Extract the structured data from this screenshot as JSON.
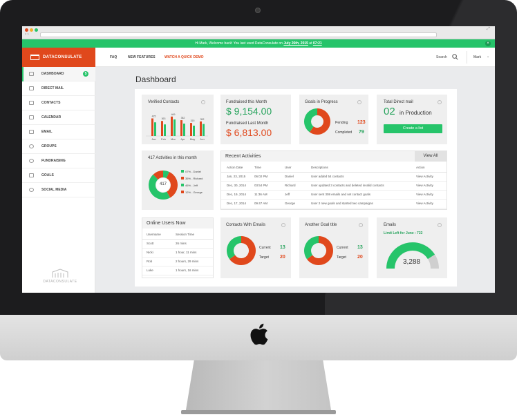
{
  "colors": {
    "green": "#26c46a",
    "orange": "#e0481c",
    "bezel": "#1c1c1e"
  },
  "welcome": {
    "prefix": "Hi Mark, Welcome back! You last used DataConsulate on ",
    "date": "July 26th, 2015",
    "mid": " at ",
    "time": "07:21"
  },
  "logo": {
    "text": "DATACONSULATE"
  },
  "topnav": {
    "faq": "FAQ",
    "features": "NEW FEATURES",
    "demo": "WATCH A QUICK DEMO",
    "search": "Search",
    "user": "Mark"
  },
  "sidebar": {
    "items": [
      {
        "label": "DASHBOARD",
        "icon": "dashboard-icon"
      },
      {
        "label": "DIRECT MAIL",
        "icon": "mail-icon"
      },
      {
        "label": "CONTACTS",
        "icon": "contacts-icon"
      },
      {
        "label": "CALENDAR",
        "icon": "calendar-icon"
      },
      {
        "label": "EMAIL",
        "icon": "email-icon"
      },
      {
        "label": "GROUPS",
        "icon": "groups-icon"
      },
      {
        "label": "FUNDRAISING",
        "icon": "fundraising-icon"
      },
      {
        "label": "GOALS",
        "icon": "goals-icon"
      },
      {
        "label": "SOCIAL MEDIA",
        "icon": "share-icon"
      }
    ],
    "badge": "5",
    "footer_logo": "DATACONSULATE"
  },
  "page": {
    "title": "Dashboard"
  },
  "verified": {
    "title": "Verified Contacts"
  },
  "chart_data": {
    "type": "bar",
    "title": "Verified Contacts",
    "categories": [
      "Jan",
      "Feb",
      "Mar",
      "Apr",
      "May",
      "Jun"
    ],
    "series": [
      {
        "values": [
          425,
          363,
          469,
          382,
          315,
          352
        ]
      },
      {
        "values": [
          330,
          280,
          400,
          300,
          250,
          290
        ]
      }
    ]
  },
  "fundraised": {
    "this_label": "Fundraised this Month",
    "this_value": "$ 9,154.00",
    "last_label": "Fundraised Last Month",
    "last_value": "$ 6,813.00"
  },
  "goals": {
    "title": "Goals in Progress",
    "pending_label": "Pending",
    "pending": "123",
    "completed_label": "Completed",
    "completed": "79",
    "pending_fraction": 0.6
  },
  "directmail": {
    "title": "Total Direct mail",
    "count": "02",
    "suffix": "in Production",
    "button": "Create a list"
  },
  "activities_donut": {
    "title": "417 Activities in this month",
    "center": "417",
    "legend": [
      {
        "label": "07% - Daniel",
        "color": "#26c46a",
        "value": 7
      },
      {
        "label": "35% - Richard",
        "color": "#e0481c",
        "value": 35
      },
      {
        "label": "46% - Jeff",
        "color": "#26c46a",
        "value": 46
      },
      {
        "label": "12% - George",
        "color": "#e0481c",
        "value": 12
      }
    ]
  },
  "recent": {
    "title": "Recent Activities",
    "view_all": "View All",
    "headers": [
      "Action Date",
      "Time",
      "User",
      "Descriptions",
      "Action"
    ],
    "rows": [
      [
        "Jan, 23, 2015",
        "06:02 PM",
        "Daniel",
        "User added 54 contacts",
        "View Activity"
      ],
      [
        "Dec, 30, 2014",
        "03:54 PM",
        "Richard",
        "User updated 3 contacts and deleted invalid contacts",
        "View Activity"
      ],
      [
        "Dec, 19, 2014",
        "11:36 AM",
        "Jeff",
        "User sent 308 emails and set contact goals",
        "View Activity"
      ],
      [
        "Dec, 17, 2014",
        "09:47 AM",
        "George",
        "User 2 new goals and started two campaigns",
        "View Activity"
      ]
    ]
  },
  "online": {
    "title": "Online Users Now",
    "headers": [
      "Username",
      "Session Time"
    ],
    "rows": [
      [
        "Scott",
        "26 mins"
      ],
      [
        "Nicki",
        "1 hour, 11 mins"
      ],
      [
        "Rob",
        "2 hours, 29 mins"
      ],
      [
        "Luke",
        "1 hours, 16 mins"
      ]
    ]
  },
  "contacts_emails": {
    "title": "Contacts With Emails",
    "current_label": "Current",
    "current": "13",
    "target_label": "Target",
    "target": "20",
    "fraction": 0.65
  },
  "another_goal": {
    "title": "Another Goal title",
    "current_label": "Current",
    "current": "13",
    "target_label": "Target",
    "target": "20",
    "fraction": 0.65
  },
  "emails": {
    "title": "Emails",
    "limit": "Limit Left for June : 722",
    "value": "3,288",
    "fraction": 0.82
  }
}
